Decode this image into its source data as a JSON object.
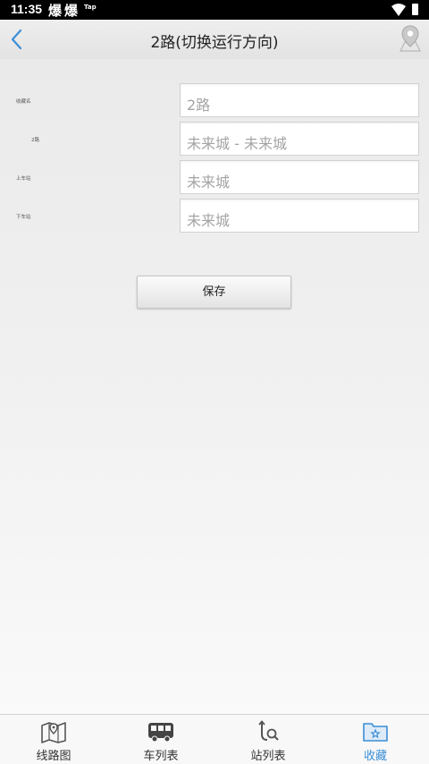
{
  "status_bar": {
    "time": "11:35",
    "notifications": [
      "爆",
      "爆",
      "Tap"
    ],
    "icons": [
      "wifi-icon",
      "battery-icon"
    ]
  },
  "header": {
    "title": "2路(切换运行方向)",
    "back_icon": "chevron-left-icon",
    "map_icon": "map-pin-icon"
  },
  "form": {
    "rows": [
      {
        "label": "收藏名",
        "value": "2路"
      },
      {
        "label": "2路",
        "value": "未来城 - 未来城"
      },
      {
        "label": "上车站",
        "value": "未来城"
      },
      {
        "label": "下车站",
        "value": "未来城"
      }
    ]
  },
  "save_button": {
    "label": "保存"
  },
  "tabs": [
    {
      "label": "线路图",
      "icon": "route-map-icon",
      "active": false
    },
    {
      "label": "车列表",
      "icon": "bus-icon",
      "active": false
    },
    {
      "label": "站列表",
      "icon": "station-search-icon",
      "active": false
    },
    {
      "label": "收藏",
      "icon": "favorites-folder-icon",
      "active": true
    }
  ],
  "colors": {
    "accent": "#3b8ed6",
    "header_bg": "#e8e8e8",
    "status_bar_bg": "#000000"
  }
}
